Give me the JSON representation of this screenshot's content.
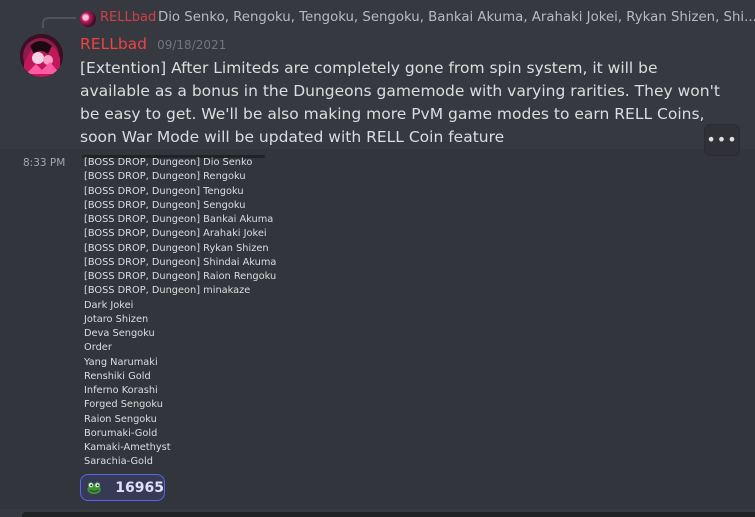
{
  "reply": {
    "author": "RELLbad",
    "preview": "Dio Senko, Rengoku, Tengoku, Sengoku, Bankai Akuma, Arahaki Jokei, Rykan Shizen, Shi..."
  },
  "message": {
    "author": "RELLbad",
    "date": "09/18/2021",
    "text": "[Extention] After Limiteds are completely gone from spin system, it will be available as a bonus in the Dungeons gamemode with varying rarities. They won't be easy to get. We'll be also making more PvM game modes to earn RELL Coins, soon War Mode will be updated with RELL Coin feature"
  },
  "followup": {
    "time": "8:33 PM",
    "items": [
      "[BOSS DROP, Dungeon] Dio Senko",
      "[BOSS DROP, Dungeon] Rengoku",
      "[BOSS DROP, Dungeon] Tengoku",
      "[BOSS DROP, Dungeon] Sengoku",
      "[BOSS DROP, Dungeon] Bankai Akuma",
      "[BOSS DROP, Dungeon] Arahaki Jokei",
      "[BOSS DROP, Dungeon] Rykan Shizen",
      "[BOSS DROP, Dungeon] Shindai Akuma",
      "[BOSS DROP, Dungeon] Raion Rengoku",
      "[BOSS DROP, Dungeon] minakaze",
      "Dark Jokei",
      "Jotaro Shizen",
      "Deva Sengoku",
      "Order",
      "Yang Narumaki",
      "Renshiki Gold",
      "Inferno Korashi",
      "Forged Sengoku",
      "Raion Sengoku",
      "Borumaki-Gold",
      "Kamaki-Amethyst",
      "Sarachia-Gold"
    ]
  },
  "reaction": {
    "emoji": "frog-emoji",
    "count": "16965"
  },
  "more_button": {
    "icon": "more-dots-icon",
    "label": "•••"
  },
  "colors": {
    "background": "#36393f",
    "author": "#ed4245",
    "reaction_border": "#5865f2"
  }
}
